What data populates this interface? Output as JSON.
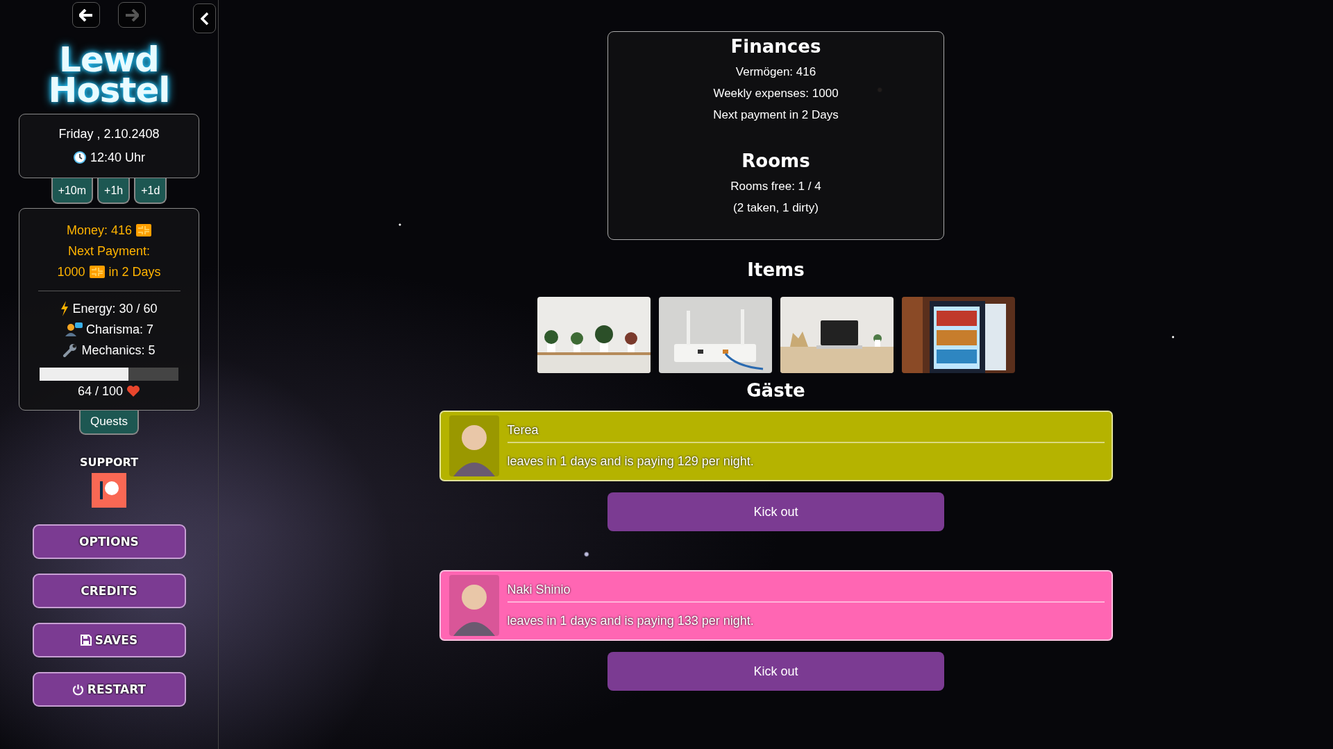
{
  "nav": [
    {
      "kind": "back",
      "disabled": false
    },
    {
      "kind": "forward",
      "disabled": true
    }
  ],
  "logo": "Lewd Hostel",
  "datetime": {
    "date": "Friday , 2.10.2408",
    "time": "12:40 Uhr"
  },
  "time_buttons": [
    "+10m",
    "+1h",
    "+1d"
  ],
  "stats": {
    "money": "Money: 416",
    "next_payment_label": "Next Payment:",
    "next_payment_amount": "1000",
    "next_payment_due": "in 2 Days",
    "attributes": [
      {
        "kind": "energy",
        "text": "Energy: 30 / 60"
      },
      {
        "kind": "charisma",
        "text": "Charisma: 7"
      },
      {
        "kind": "mechanics",
        "text": "Mechanics: 5"
      }
    ],
    "health": {
      "level": 0.64,
      "text": "64 / 100"
    }
  },
  "quests_tab": "Quests",
  "support_label": "SUPPORT",
  "menu_buttons": [
    {
      "kind": "plain",
      "label": "OPTIONS"
    },
    {
      "kind": "plain",
      "label": "CREDITS"
    },
    {
      "kind": "save",
      "label": "SAVES"
    },
    {
      "kind": "power",
      "label": "RESTART"
    }
  ],
  "finances": {
    "title": "Finances",
    "lines": [
      "Vermögen: 416",
      "Weekly expenses: 1000",
      "Next payment in 2 Days"
    ]
  },
  "rooms": {
    "title": "Rooms",
    "lines": [
      "Rooms free: 1 / 4",
      "(2 taken, 1 dirty)"
    ]
  },
  "items": {
    "title": "Items"
  },
  "guests": {
    "title": "Gäste",
    "list": [
      {
        "name": "Terea",
        "text": "leaves in 1 days and is paying 129 per night.",
        "color": "#b5b300",
        "action": "Kick out"
      },
      {
        "name": "Naki Shinio",
        "text": "leaves in 1 days and is paying 133 per night.",
        "color": "#ff66b3",
        "action": "Kick out"
      }
    ]
  }
}
